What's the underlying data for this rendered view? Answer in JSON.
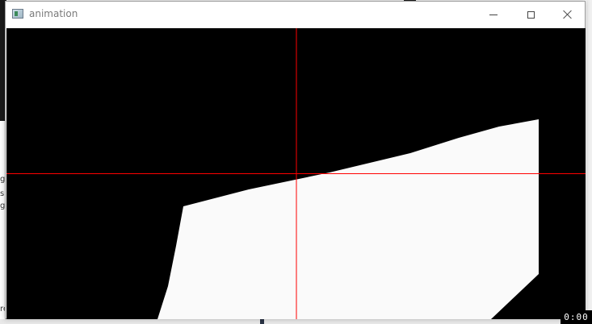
{
  "window": {
    "title": "animation",
    "minimize_icon": "minimize-icon",
    "maximize_icon": "maximize-icon",
    "close_icon": "close-icon",
    "app_icon": "app-window-icon"
  },
  "canvas": {
    "background_color": "#000000",
    "shape_color": "#fafafa",
    "crosshair_color": "#ff0000"
  },
  "background": {
    "text_fragments": [
      "gh",
      "s",
      "gh",
      "re"
    ]
  },
  "timer": {
    "text": "0:00"
  }
}
